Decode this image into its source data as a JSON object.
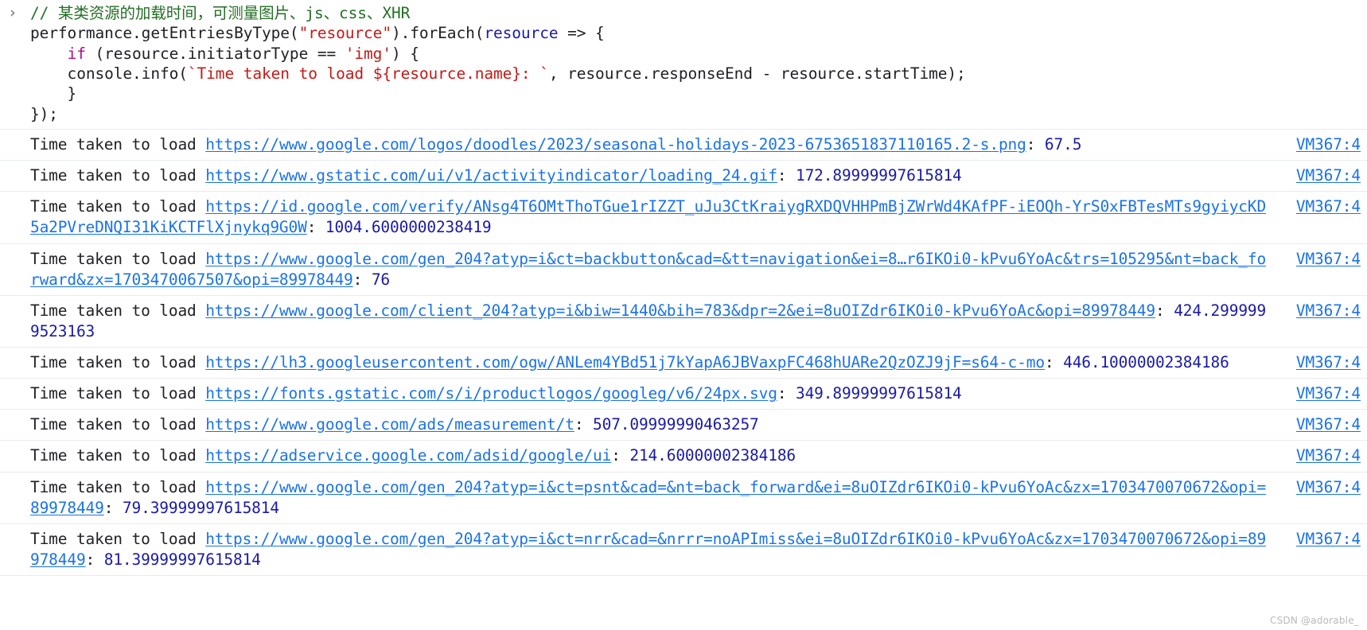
{
  "console": {
    "prompt_symbol": "›",
    "code_lines": [
      [
        {
          "t": "comment",
          "s": "// 某类资源的加载时间，可测量图片、js、css、XHR"
        }
      ],
      [
        {
          "t": "plain",
          "s": "performance.getEntriesByType("
        },
        {
          "t": "string",
          "s": "\"resource\""
        },
        {
          "t": "plain",
          "s": ").forEach("
        },
        {
          "t": "param",
          "s": "resource"
        },
        {
          "t": "plain",
          "s": " => {"
        }
      ],
      [
        {
          "t": "plain",
          "s": "    "
        },
        {
          "t": "kw",
          "s": "if"
        },
        {
          "t": "plain",
          "s": " (resource.initiatorType == "
        },
        {
          "t": "string",
          "s": "'img'"
        },
        {
          "t": "plain",
          "s": ") {"
        }
      ],
      [
        {
          "t": "plain",
          "s": "    console.info("
        },
        {
          "t": "string",
          "s": "`Time taken to load ${resource.name}: `"
        },
        {
          "t": "plain",
          "s": ", resource.responseEnd - resource.startTime);"
        }
      ],
      [
        {
          "t": "plain",
          "s": "    }"
        }
      ],
      [
        {
          "t": "plain",
          "s": "});"
        }
      ]
    ]
  },
  "log": {
    "prefix": "Time taken to load ",
    "separator": ": ",
    "source_label": "VM367:4",
    "entries": [
      {
        "url": "https://www.google.com/logos/doodles/2023/seasonal-holidays-2023-6753651837110165.2-s.png",
        "value": "67.5",
        "source": "VM367:4"
      },
      {
        "url": "https://www.gstatic.com/ui/v1/activityindicator/loading_24.gif",
        "value": "172.89999997615814",
        "source": "VM367:4"
      },
      {
        "url": "https://id.google.com/verify/ANsg4T6OMtThoTGue1rIZZT_uJu3CtKraiygRXDQVHHPmBjZWrWd4KAfPF-iEOQh-YrS0xFBTesMTs9gyiycKD5a2PVreDNQI31KiKCTFlXjnykq9G0W",
        "value": "1004.6000000238419",
        "source": "VM367:4"
      },
      {
        "url": "https://www.google.com/gen_204?atyp=i&ct=backbutton&cad=&tt=navigation&ei=8…r6IKOi0-kPvu6YoAc&trs=105295&nt=back_forward&zx=1703470067507&opi=89978449",
        "value": "76",
        "source": "VM367:4"
      },
      {
        "url": "https://www.google.com/client_204?atyp=i&biw=1440&bih=783&dpr=2&ei=8uOIZdr6IKOi0-kPvu6YoAc&opi=89978449",
        "value": "424.2999999523163",
        "source": "VM367:4"
      },
      {
        "url": "https://lh3.googleusercontent.com/ogw/ANLem4YBd51j7kYapA6JBVaxpFC468hUARe2QzOZJ9jF=s64-c-mo",
        "value": "446.10000002384186",
        "source": "VM367:4"
      },
      {
        "url": "https://fonts.gstatic.com/s/i/productlogos/googleg/v6/24px.svg",
        "value": "349.89999997615814",
        "source": "VM367:4"
      },
      {
        "url": "https://www.google.com/ads/measurement/t",
        "value": "507.09999990463257",
        "source": "VM367:4"
      },
      {
        "url": "https://adservice.google.com/adsid/google/ui",
        "value": "214.60000002384186",
        "source": "VM367:4"
      },
      {
        "url": "https://www.google.com/gen_204?atyp=i&ct=psnt&cad=&nt=back_forward&ei=8uOIZdr6IKOi0-kPvu6YoAc&zx=1703470070672&opi=89978449",
        "value": "79.39999997615814",
        "source": "VM367:4"
      },
      {
        "url": "https://www.google.com/gen_204?atyp=i&ct=nrr&cad=&nrrr=noAPImiss&ei=8uOIZdr6IKOi0-kPvu6YoAc&zx=1703470070672&opi=89978449",
        "value": "81.39999997615814",
        "source": "VM367:4"
      }
    ]
  },
  "watermark": {
    "text": "CSDN @adorable_"
  },
  "colors": {
    "link": "#1a73e8",
    "value": "#1a1aa6",
    "comment": "#236e25",
    "string": "#c41a16",
    "keyword": "#aa0d91",
    "param": "#1a1aa6",
    "row_divider": "#e7ebf1"
  }
}
